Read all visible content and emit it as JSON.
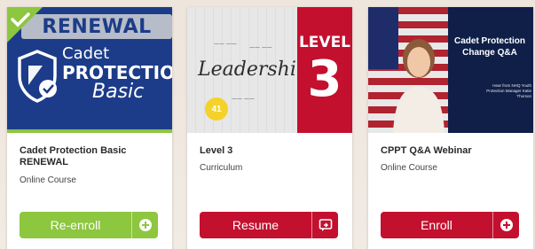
{
  "cards": [
    {
      "thumbnail": {
        "banner": "RENEWAL",
        "brand_line1": "Cadet",
        "brand_line2": "PROTECTION",
        "brand_line3": "Basic"
      },
      "title_line1": "Cadet Protection Basic",
      "title_line2": "RENEWAL",
      "type": "Online Course",
      "button_label": "Re-enroll",
      "button_icon": "plus-circle-icon"
    },
    {
      "thumbnail": {
        "word": "Leadership",
        "level_word": "LEVEL",
        "level_number": "3",
        "badge_count": "41"
      },
      "title_line1": "Level 3",
      "type": "Curriculum",
      "button_label": "Resume",
      "button_icon": "resume-icon"
    },
    {
      "thumbnail": {
        "heading_line1": "Cadet Protection",
        "heading_line2": "Change Q&A",
        "subtext_line1": "Hear from NHQ Youth",
        "subtext_line2": "Protection Manager Katie",
        "subtext_line3": "Thorson"
      },
      "title_line1": "CPPT Q&A Webinar",
      "type": "Online Course",
      "button_label": "Enroll",
      "button_icon": "plus-circle-icon"
    }
  ],
  "colors": {
    "green": "#8dc63f",
    "red": "#c3102f",
    "navy": "#1c3c8a"
  }
}
